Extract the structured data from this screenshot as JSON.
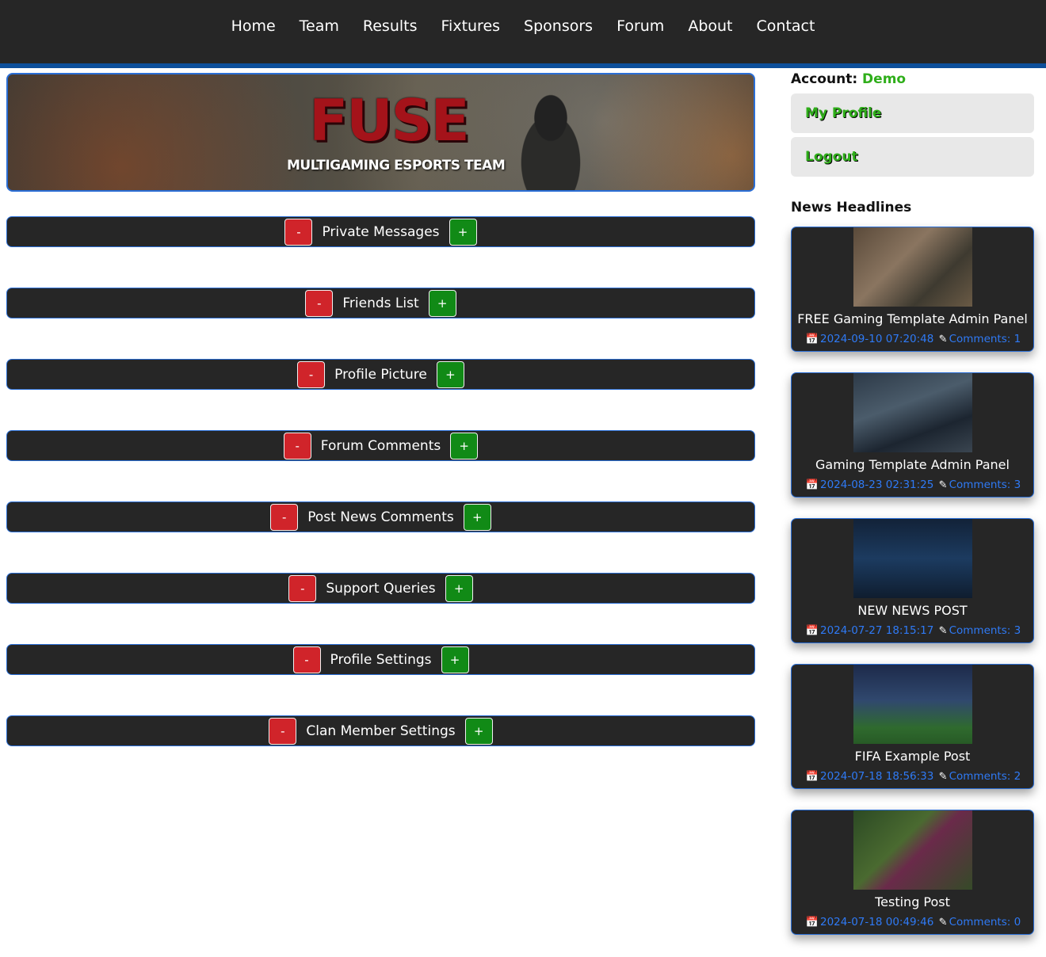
{
  "nav": [
    "Home",
    "Team",
    "Results",
    "Fixtures",
    "Sponsors",
    "Forum",
    "About",
    "Contact"
  ],
  "banner": {
    "logo": "FUSE",
    "tagline": "MULTIGAMING ESPORTS TEAM"
  },
  "sections": [
    {
      "label": "Private Messages"
    },
    {
      "label": "Friends List"
    },
    {
      "label": "Profile Picture"
    },
    {
      "label": "Forum Comments"
    },
    {
      "label": "Post News Comments"
    },
    {
      "label": "Support Queries"
    },
    {
      "label": "Profile Settings"
    },
    {
      "label": "Clan Member Settings"
    }
  ],
  "buttons": {
    "minus": "-",
    "plus": "+"
  },
  "sidebar": {
    "account_label": "Account:",
    "account_name": "Demo",
    "links": [
      "My Profile",
      "Logout"
    ],
    "headlines_title": "News Headlines"
  },
  "news": [
    {
      "title": "FREE Gaming Template Admin Panel",
      "date": "2024-09-10 07:20:48",
      "comments": "Comments: 1"
    },
    {
      "title": "Gaming Template Admin Panel",
      "date": "2024-08-23 02:31:25",
      "comments": "Comments: 3"
    },
    {
      "title": "NEW NEWS POST",
      "date": "2024-07-27 18:15:17",
      "comments": "Comments: 3"
    },
    {
      "title": "FIFA Example Post",
      "date": "2024-07-18 18:56:33",
      "comments": "Comments: 2"
    },
    {
      "title": "Testing Post",
      "date": "2024-07-18 00:49:46",
      "comments": "Comments: 0"
    }
  ],
  "icons": {
    "calendar": "calendar-icon",
    "edit": "edit-icon"
  },
  "colors": {
    "nav_bg": "#262626",
    "accent_blue": "#2a6ed6",
    "minus_red": "#d0242a",
    "plus_green": "#118a16",
    "account_green": "#2fae1a",
    "meta_blue": "#2f7af5"
  }
}
